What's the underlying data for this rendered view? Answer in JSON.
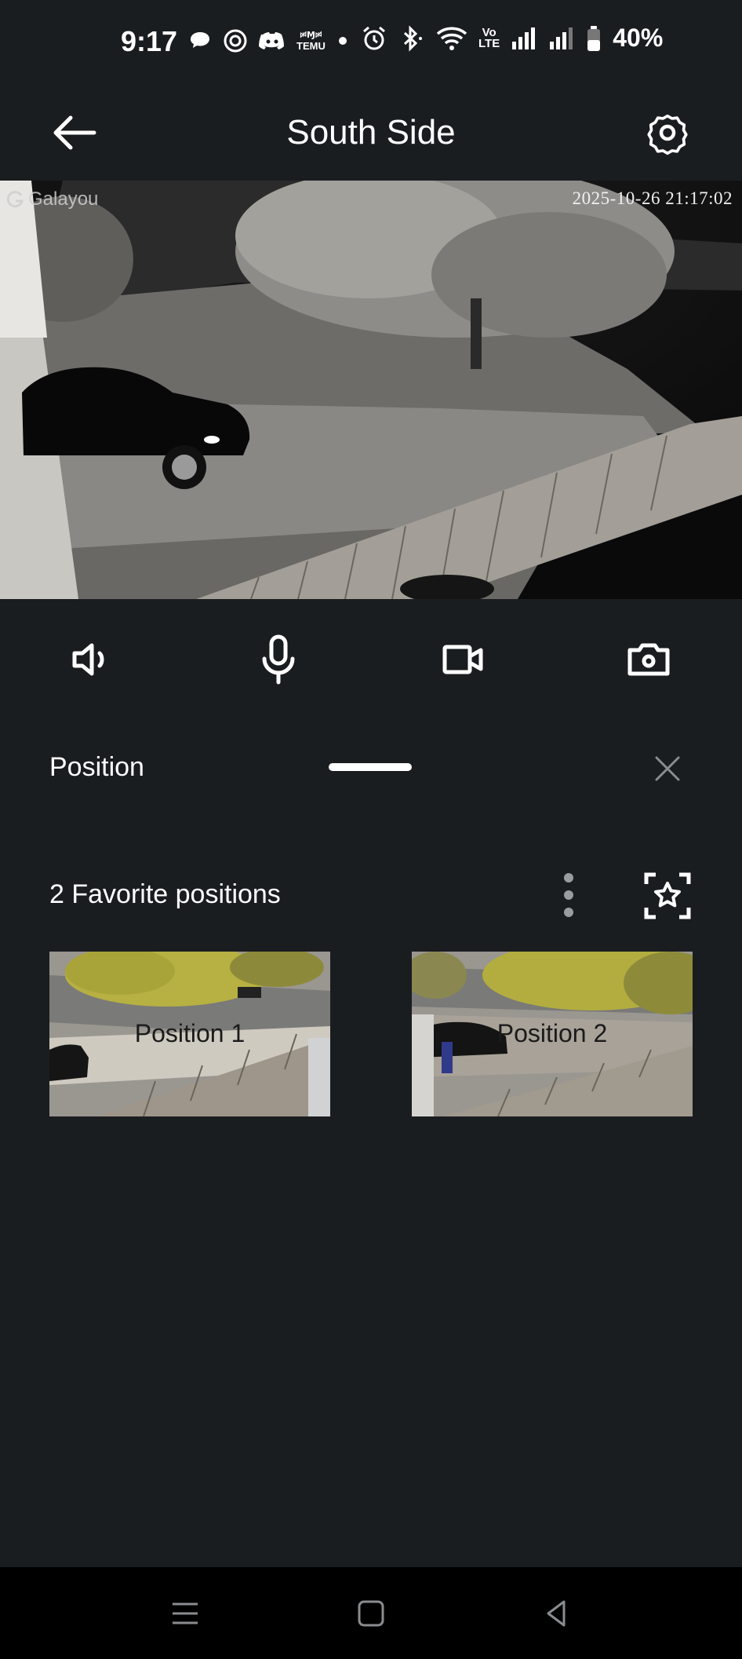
{
  "status_bar": {
    "time": "9:17",
    "left_icons": [
      "chat-bubble-icon",
      "threads-icon",
      "discord-icon",
      "temu-icon",
      "dot-icon"
    ],
    "temu_label_top": "ꗰⱮꗰ",
    "temu_label_bottom": "TEMU",
    "right_icons": [
      "alarm-icon",
      "bluetooth-icon",
      "wifi-icon",
      "volte-icon",
      "signal-icon",
      "signal-icon",
      "battery-icon"
    ],
    "volte_top": "Vo",
    "volte_bottom": "LTE",
    "battery": "40%"
  },
  "header": {
    "title": "South Side",
    "back_icon": "arrow-left-icon",
    "settings_icon": "gear-icon"
  },
  "live_view": {
    "watermark": "Galayou",
    "timestamp": "2025-10-26 21:17:02"
  },
  "controls": {
    "icons": [
      "speaker-icon",
      "microphone-icon",
      "video-record-icon",
      "camera-snapshot-icon"
    ]
  },
  "position_panel": {
    "title": "Position",
    "close_icon": "close-icon"
  },
  "favorites": {
    "title": "2 Favorite positions",
    "more_icon": "more-vertical-icon",
    "add_icon": "add-favorite-position-icon",
    "items": [
      {
        "label": "Position 1"
      },
      {
        "label": "Position 2"
      }
    ]
  },
  "nav_bar": {
    "icons": [
      "recent-apps-icon",
      "home-icon",
      "back-icon"
    ]
  },
  "colors": {
    "background": "#1a1d20",
    "nav_background": "#000000",
    "text": "#ffffff",
    "muted_icon": "#8a8d90"
  }
}
